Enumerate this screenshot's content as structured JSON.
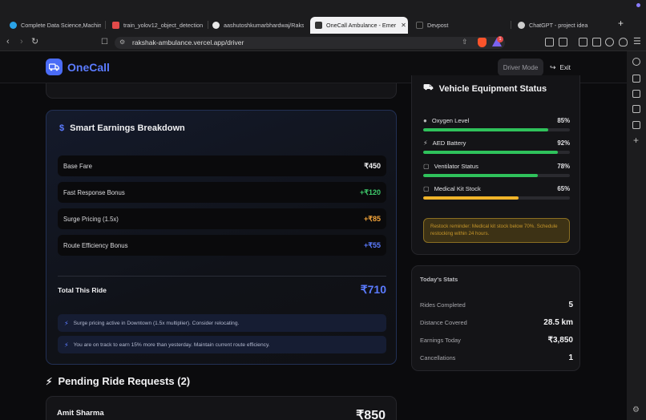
{
  "browser": {
    "tabs": [
      {
        "title": "Complete Data Science,Machine",
        "color": "#2aa3e8"
      },
      {
        "title": "train_yolov12_object_detection",
        "color": "#e24a4a"
      },
      {
        "title": "aashutoshkumarbhardwaj/Raksh",
        "color": "#e8e8e8"
      },
      {
        "title": "OneCall Ambulance - Emer",
        "color": "#333333"
      },
      {
        "title": "Devpost",
        "color": "#1a1a1a"
      },
      {
        "title": "ChatGPT - project idea",
        "color": "#cccccc"
      }
    ],
    "new_tab": "+",
    "url": "rakshak-ambulance.vercel.app/driver",
    "rewards_count": "1"
  },
  "app": {
    "brand": "OneCall",
    "mode_button": "Driver Mode",
    "exit_button": "Exit"
  },
  "earnings": {
    "title": "Smart Earnings Breakdown",
    "rows": [
      {
        "label": "Base Fare",
        "amount": "₹450"
      },
      {
        "label": "Fast Response Bonus",
        "amount": "+₹120"
      },
      {
        "label": "Surge Pricing (1.5x)",
        "amount": "+₹85"
      },
      {
        "label": "Route Efficiency Bonus",
        "amount": "+₹55"
      }
    ],
    "total_label": "Total This Ride",
    "total_value": "₹710",
    "notes": [
      "Surge pricing active in Downtown (1.5x multiplier). Consider relocating.",
      "You are on track to earn 15% more than yesterday. Maintain current route efficiency."
    ]
  },
  "pending": {
    "title": "Pending Ride Requests (2)",
    "first_name": "Amit Sharma",
    "first_fare": "₹850"
  },
  "equipment": {
    "title": "Vehicle Equipment Status",
    "items": [
      {
        "name": "Oxygen Level",
        "pct": "85%",
        "level": 0.85,
        "color": "#2fc25b"
      },
      {
        "name": "AED Battery",
        "pct": "92%",
        "level": 0.92,
        "color": "#2fc25b"
      },
      {
        "name": "Ventilator Status",
        "pct": "78%",
        "level": 0.78,
        "color": "#2fc25b"
      },
      {
        "name": "Medical Kit Stock",
        "pct": "65%",
        "level": 0.65,
        "color": "#f0b429"
      }
    ],
    "alert": "Restock reminder: Medical kit stock below 70%. Schedule restocking within 24 hours."
  },
  "stats": {
    "title": "Today's Stats",
    "rows": [
      {
        "label": "Rides Completed",
        "value": "5"
      },
      {
        "label": "Distance Covered",
        "value": "28.5 km"
      },
      {
        "label": "Earnings Today",
        "value": "₹3,850"
      },
      {
        "label": "Cancellations",
        "value": "1"
      }
    ]
  },
  "colors": {
    "accent": "#5b7bff",
    "success": "#2fc25b",
    "warning": "#f0b429"
  }
}
